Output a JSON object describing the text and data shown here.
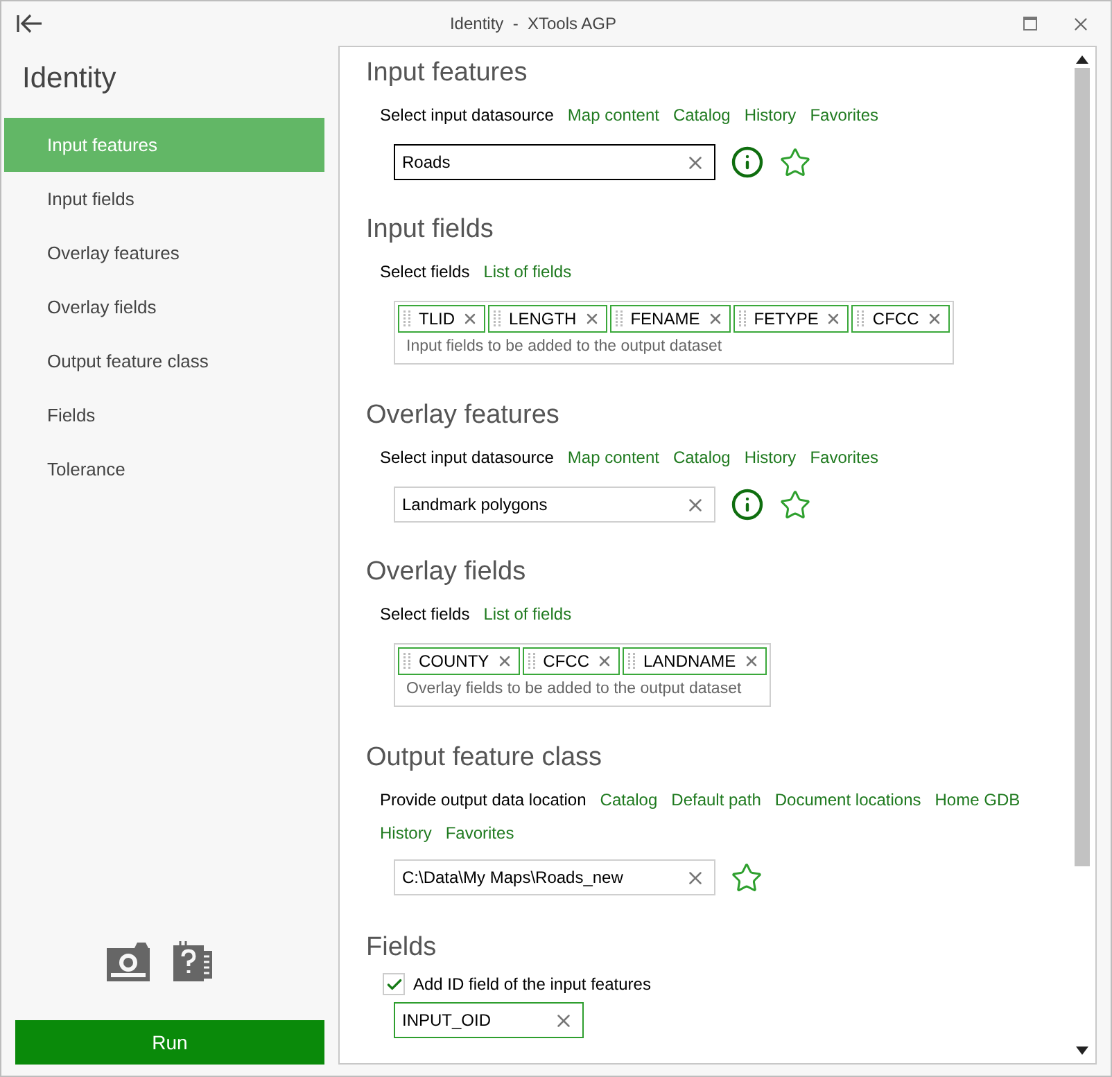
{
  "window": {
    "title": "Identity  -  XTools AGP"
  },
  "sidebar": {
    "title": "Identity",
    "items": [
      {
        "label": "Input features",
        "selected": true
      },
      {
        "label": "Input fields",
        "selected": false
      },
      {
        "label": "Overlay features",
        "selected": false
      },
      {
        "label": "Overlay fields",
        "selected": false
      },
      {
        "label": "Output feature class",
        "selected": false
      },
      {
        "label": "Fields",
        "selected": false
      },
      {
        "label": "Tolerance",
        "selected": false
      }
    ],
    "run_button": "Run"
  },
  "sections": [
    {
      "kind": "datasource",
      "title": "Input features",
      "prompt": "Select input datasource",
      "links": [
        "Map content",
        "Catalog",
        "History",
        "Favorites"
      ],
      "value": "Roads",
      "focused": true
    },
    {
      "kind": "fields",
      "title": "Input fields",
      "prompt": "Select fields",
      "links": [
        "List of fields"
      ],
      "chips": [
        "TLID",
        "LENGTH",
        "FENAME",
        "FETYPE",
        "CFCC"
      ],
      "hint": "Input fields to be added to the output dataset"
    },
    {
      "kind": "datasource",
      "title": "Overlay features",
      "prompt": "Select input datasource",
      "links": [
        "Map content",
        "Catalog",
        "History",
        "Favorites"
      ],
      "value": "Landmark polygons",
      "focused": false
    },
    {
      "kind": "fields",
      "title": "Overlay fields",
      "prompt": "Select fields",
      "links": [
        "List of fields"
      ],
      "chips": [
        "COUNTY",
        "CFCC",
        "LANDNAME"
      ],
      "hint": "Overlay fields to be added to the output dataset"
    },
    {
      "kind": "output",
      "title": "Output feature class",
      "prompt": "Provide output data location",
      "links": [
        "Catalog",
        "Default path",
        "Document locations",
        "Home GDB",
        "History",
        "Favorites"
      ],
      "value": "C:\\Data\\My Maps\\Roads_new",
      "focused": false
    },
    {
      "kind": "checkbox",
      "title": "Fields",
      "label": "Add ID field of the input features",
      "checked": true,
      "value": "INPUT_OID",
      "focused": true
    }
  ]
}
